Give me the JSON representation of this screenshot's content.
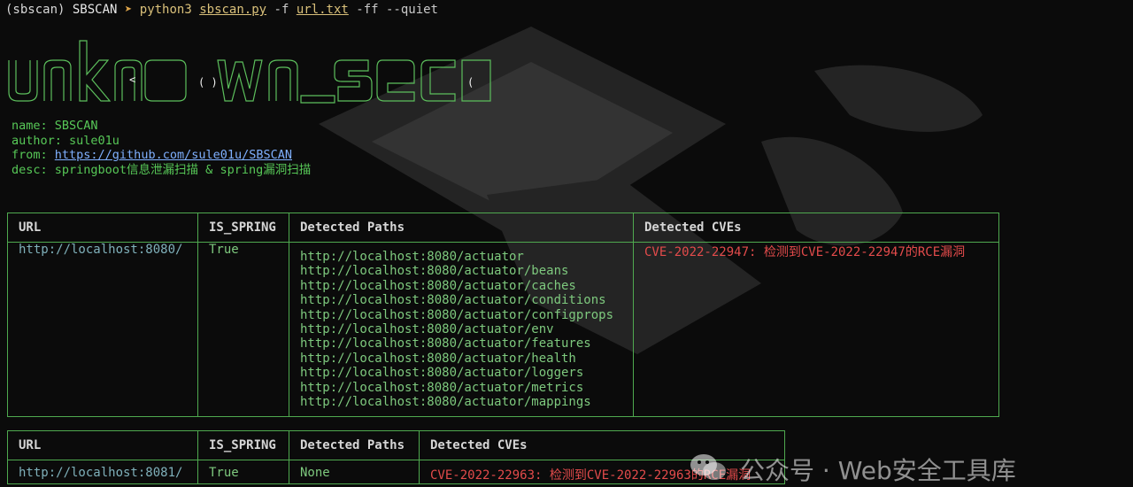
{
  "terminal": {
    "env": "(sbscan)",
    "app": "SBSCAN",
    "arrow": "➤",
    "command": "python3",
    "script": "sbscan.py",
    "flag_f": "-f",
    "file": "url.txt",
    "flags_rest": "-ff --quiet"
  },
  "banner": {
    "text": "unknown_sec"
  },
  "info": {
    "name_label": "name: ",
    "name": "SBSCAN",
    "author_label": "author: ",
    "author": "sule01u",
    "from_label": "from: ",
    "from": "https://github.com/sule01u/SBSCAN",
    "desc_label": "desc: ",
    "desc": "springboot信息泄漏扫描 & spring漏洞扫描"
  },
  "table1": {
    "headers": [
      "URL",
      "IS_SPRING",
      "Detected Paths",
      "Detected CVEs"
    ],
    "url": "http://localhost:8080/",
    "is_spring": "True",
    "paths": [
      "http://localhost:8080/actuator",
      "http://localhost:8080/actuator/beans",
      "http://localhost:8080/actuator/caches",
      "http://localhost:8080/actuator/conditions",
      "http://localhost:8080/actuator/configprops",
      "http://localhost:8080/actuator/env",
      "http://localhost:8080/actuator/features",
      "http://localhost:8080/actuator/health",
      "http://localhost:8080/actuator/loggers",
      "http://localhost:8080/actuator/metrics",
      "http://localhost:8080/actuator/mappings"
    ],
    "cve": "CVE-2022-22947: 检测到CVE-2022-22947的RCE漏洞"
  },
  "table2": {
    "headers": [
      "URL",
      "IS_SPRING",
      "Detected Paths",
      "Detected CVEs"
    ],
    "url": "http://localhost:8081/",
    "is_spring": "True",
    "paths": "None",
    "cve": "CVE-2022-22963: 检测到CVE-2022-22963的RCE漏洞"
  },
  "watermark": {
    "text": "公众号 · Web安全工具库"
  },
  "colors": {
    "background": "#0b0b0b",
    "green": "#57c857",
    "border": "#4fa94f",
    "cve_red": "#e34b4b"
  }
}
